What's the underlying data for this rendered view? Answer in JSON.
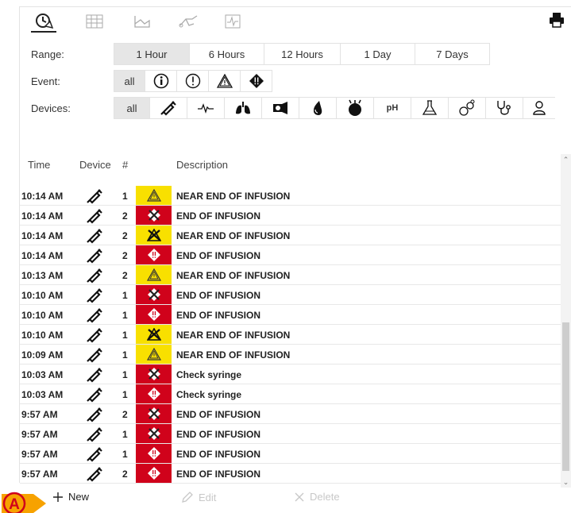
{
  "toolbar": {
    "icons": [
      "clock-alarm-icon",
      "grid-icon",
      "chart-icon",
      "stethoscope-icon",
      "waveform-icon",
      "printer-icon"
    ]
  },
  "filters": {
    "range_label": "Range:",
    "range_options": [
      "1 Hour",
      "6 Hours",
      "12 Hours",
      "1 Day",
      "7 Days"
    ],
    "range_selected": "1 Hour",
    "event_label": "Event:",
    "event_all": "all",
    "event_icons": [
      "info-icon",
      "exclamation-icon",
      "warning-triangle-icon",
      "alarm-diamond-icon"
    ],
    "devices_label": "Devices:",
    "devices_all": "all",
    "devices_ph": "pH",
    "device_icons": [
      "syringe-icon",
      "ecg-icon",
      "lungs-icon",
      "pump-icon",
      "drop-icon",
      "kidney-icon",
      "bomb-icon",
      "ph-icon",
      "flask-icon",
      "gas-icon",
      "stethoscope-icon",
      "person-icon"
    ]
  },
  "list": {
    "headers": {
      "time": "Time",
      "device": "Device",
      "count": "#",
      "description": "Description"
    },
    "rows": [
      {
        "time": "10:14 AM",
        "count": "1",
        "severity": "warning",
        "description": "NEAR END OF INFUSION"
      },
      {
        "time": "10:14 AM",
        "count": "2",
        "severity": "alarm-x",
        "description": "END OF INFUSION"
      },
      {
        "time": "10:14 AM",
        "count": "2",
        "severity": "warning-x",
        "description": "NEAR END OF INFUSION"
      },
      {
        "time": "10:14 AM",
        "count": "2",
        "severity": "alarm",
        "description": "END OF INFUSION"
      },
      {
        "time": "10:13 AM",
        "count": "2",
        "severity": "warning",
        "description": "NEAR END OF INFUSION"
      },
      {
        "time": "10:10 AM",
        "count": "1",
        "severity": "alarm-x",
        "description": "END OF INFUSION"
      },
      {
        "time": "10:10 AM",
        "count": "1",
        "severity": "alarm",
        "description": "END OF INFUSION"
      },
      {
        "time": "10:10 AM",
        "count": "1",
        "severity": "warning-x",
        "description": "NEAR END OF INFUSION"
      },
      {
        "time": "10:09 AM",
        "count": "1",
        "severity": "warning",
        "description": "NEAR END OF INFUSION"
      },
      {
        "time": "10:03 AM",
        "count": "1",
        "severity": "alarm-x",
        "description": "Check syringe"
      },
      {
        "time": "10:03 AM",
        "count": "1",
        "severity": "alarm",
        "description": "Check syringe"
      },
      {
        "time": "9:57 AM",
        "count": "2",
        "severity": "alarm-x",
        "description": "END OF INFUSION"
      },
      {
        "time": "9:57 AM",
        "count": "1",
        "severity": "alarm-x",
        "description": "END OF INFUSION"
      },
      {
        "time": "9:57 AM",
        "count": "1",
        "severity": "alarm",
        "description": "END OF INFUSION"
      },
      {
        "time": "9:57 AM",
        "count": "2",
        "severity": "alarm",
        "description": "END OF INFUSION"
      }
    ]
  },
  "actions": {
    "new_label": "New",
    "edit_label": "Edit",
    "delete_label": "Delete"
  },
  "marker": {
    "letter": "A"
  },
  "colors": {
    "alarm": "#d0021b",
    "warning": "#f8e000",
    "marker": "#f7a200",
    "selected": "#e6e6e6"
  }
}
